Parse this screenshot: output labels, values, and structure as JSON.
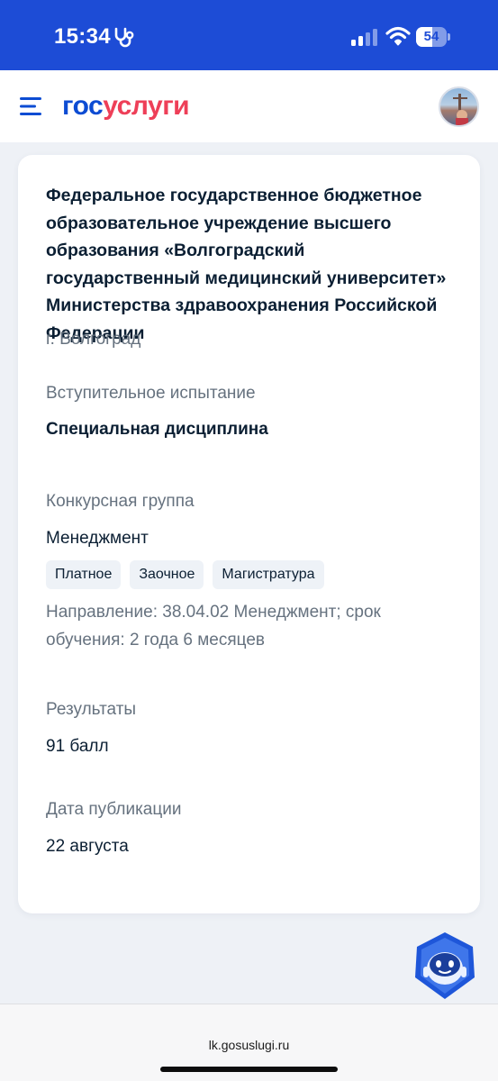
{
  "status_bar": {
    "time": "15:34",
    "battery_level": "54",
    "battery_fraction": 0.54,
    "icons": [
      "stethoscope-icon",
      "signal-icon",
      "wifi-icon",
      "battery-icon"
    ]
  },
  "header": {
    "logo_part1": "гос",
    "logo_part2": "услуги",
    "colors": {
      "brand_blue": "#0d4cd3",
      "brand_red": "#ee3f58",
      "status_bar": "#1d4cd6"
    }
  },
  "card": {
    "institution": "Федеральное государственное бюджетное образовательное учреждение высшего образования «Волгоградский государственный медицинский университет» Министерства здравоохранения Российской Федерации",
    "city": "г. Волгоград",
    "exam_label": "Вступительное испытание",
    "exam_value": "Специальная дисциплина",
    "group_label": "Конкурсная группа",
    "group_value": "Менеджмент",
    "tags": [
      "Платное",
      "Заочное",
      "Магистратура"
    ],
    "direction": "Направление: 38.04.02 Менеджмент; срок обучения: 2 года 6 месяцев",
    "results_label": "Результаты",
    "results_value": "91 балл",
    "pubdate_label": "Дата публикации",
    "pubdate_value": "22 августа"
  },
  "browser": {
    "url": "lk.gosuslugi.ru"
  }
}
